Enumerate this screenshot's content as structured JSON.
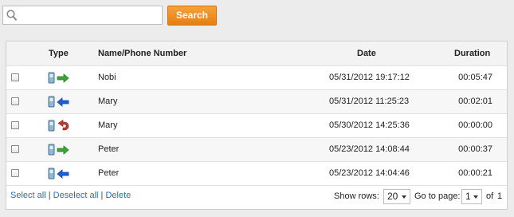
{
  "search": {
    "value": "",
    "placeholder": "",
    "button_label": "Search"
  },
  "table": {
    "headers": {
      "type": "Type",
      "name": "Name/Phone Number",
      "date": "Date",
      "duration": "Duration"
    },
    "rows": [
      {
        "direction": "outgoing",
        "arrow_icon": "green-right-arrow-icon",
        "name": "Nobi",
        "date": "05/31/2012 19:17:12",
        "duration": "00:05:47"
      },
      {
        "direction": "incoming",
        "arrow_icon": "blue-left-arrow-icon",
        "name": "Mary",
        "date": "05/31/2012 11:25:23",
        "duration": "00:02:01"
      },
      {
        "direction": "missed",
        "arrow_icon": "red-u-turn-arrow-icon",
        "name": "Mary",
        "date": "05/30/2012 14:25:36",
        "duration": "00:00:00"
      },
      {
        "direction": "outgoing",
        "arrow_icon": "green-right-arrow-icon",
        "name": "Peter",
        "date": "05/23/2012 14:08:44",
        "duration": "00:00:37"
      },
      {
        "direction": "incoming",
        "arrow_icon": "blue-left-arrow-icon",
        "name": "Peter",
        "date": "05/23/2012 14:04:46",
        "duration": "00:00:21"
      }
    ]
  },
  "footer": {
    "select_all": "Select all",
    "deselect_all": "Deselect all",
    "delete": "Delete",
    "separator": "|",
    "show_rows_label": "Show rows:",
    "show_rows_value": "20",
    "go_to_page_label": "Go to page:",
    "page_value": "1",
    "of_label": "of",
    "total_pages": "1"
  },
  "colors": {
    "accent": "#e98a1c",
    "link": "#2a6fb5",
    "outgoing": "#3ea33a",
    "incoming": "#1d5fd6",
    "missed": "#c0392b"
  }
}
